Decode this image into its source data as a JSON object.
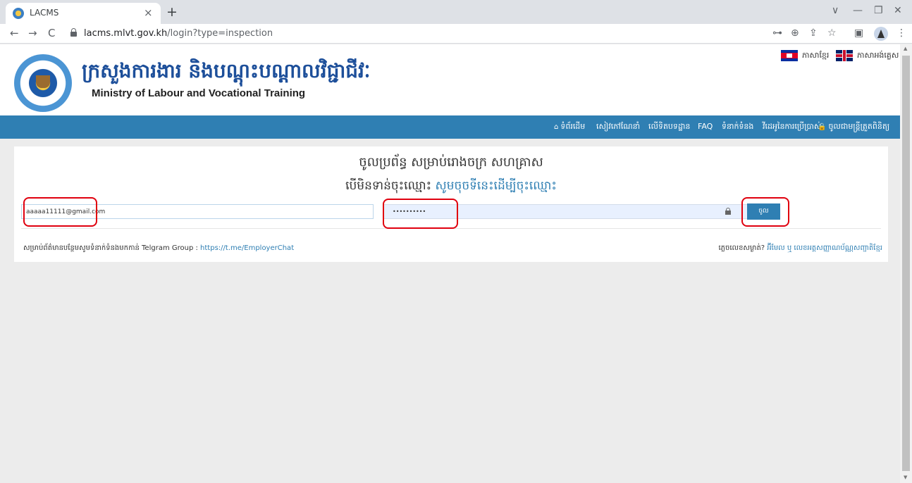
{
  "browser": {
    "tab_title": "LACMS",
    "tab_close": "×",
    "new_tab": "+",
    "url_host": "lacms.mlvt.gov.kh",
    "url_path": "/login?type=inspection",
    "back": "←",
    "forward": "→",
    "reload": "C",
    "window_controls": {
      "dropdown": "∨",
      "minimize": "—",
      "restore": "❐",
      "close": "✕"
    },
    "toolbar_icons": {
      "key": "⊶",
      "zoom": "⊕",
      "share": "⇪",
      "star": "☆",
      "sidepanel": "▣",
      "menu": "⋮"
    }
  },
  "header": {
    "khmer_title": "ក្រសួងការងារ និងបណ្តុះបណ្តាលវិជ្ជាជីវៈ",
    "english_title": "Ministry of Labour and Vocational Training",
    "lang_khmer": "ភាសាខ្មែរ",
    "lang_english": "ភាសាអង់គ្លេស"
  },
  "nav": {
    "items": [
      {
        "label": "ទំព័រដើម",
        "icon": "home-icon",
        "glyph": "⌂"
      },
      {
        "label": "សៀវភៅណែនាំ",
        "icon": "",
        "glyph": ""
      },
      {
        "label": "លើទិតបទដ្ឋាន",
        "icon": "",
        "glyph": ""
      },
      {
        "label": "FAQ",
        "icon": "",
        "glyph": ""
      },
      {
        "label": "ទំនាក់ទំនង",
        "icon": "",
        "glyph": ""
      },
      {
        "label": "វីដេអូនៃការប្រើប្រាស់",
        "icon": "",
        "glyph": ""
      },
      {
        "label": "ចូលជាមន្ត្រីត្រួតពិនិត្យ",
        "icon": "lock-icon",
        "glyph": "🔒"
      }
    ]
  },
  "login": {
    "heading": "ចូលប្រព័ន្ធ សម្រាប់រោងចក្រ សហគ្រាស",
    "subheading_prefix": "បើមិនទាន់ចុះឈ្មោះ",
    "subheading_link": "សូមចុចទីនេះដើម្បីចុះឈ្មោះ",
    "email_value": "aaaaa11111@gmail.com",
    "password_value": "••••••••••",
    "submit_label": "ចូល",
    "contact_text": "សម្រាប់ព័ត៌មានបន្ថែមសូមទំនាក់ទំនងមកកាន់ Telgram Group : ",
    "contact_link": "https://t.me/EmployerChat",
    "forgot_text": "ភ្លេចលេខសម្ងាត់?",
    "forgot_link": "អ៊ីមែល ឬ លេខអត្តសញ្ញាណប័ណ្ណសញ្ជាតិខ្មែរ"
  },
  "colors": {
    "brand_blue": "#2f7fb3",
    "title_blue": "#1d4f9a",
    "highlight_red": "#e0000e"
  }
}
